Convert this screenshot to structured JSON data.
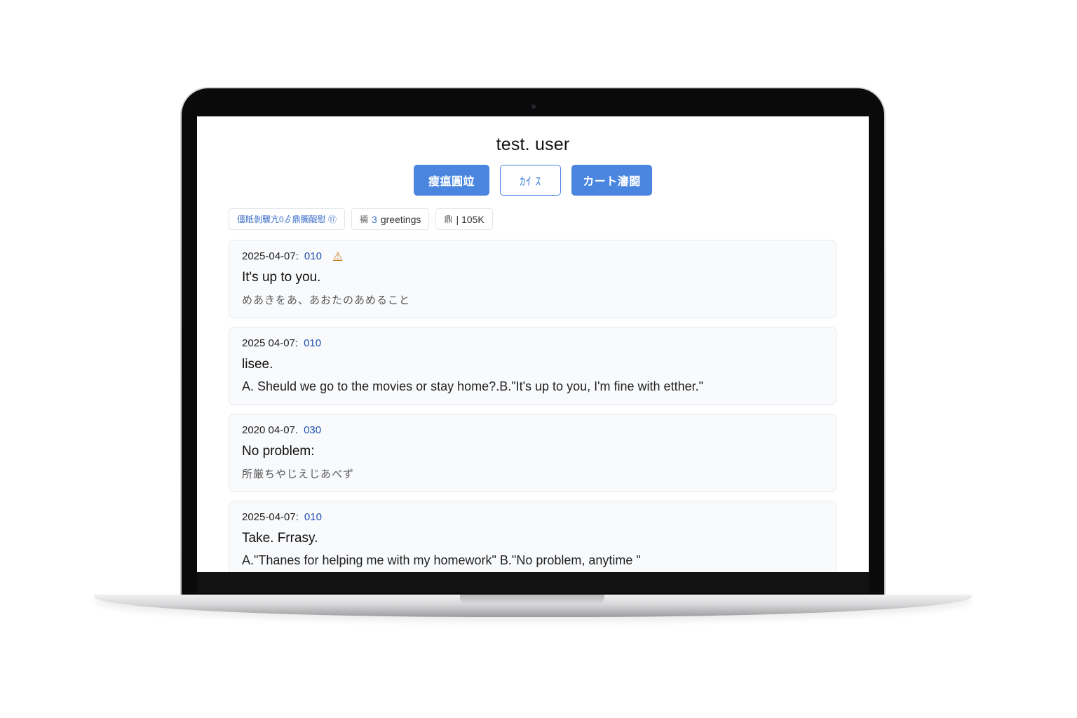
{
  "app": {
    "title": "test. user"
  },
  "actions": [
    {
      "label": "瘦瘟圓竝"
    },
    {
      "label": "ｶｲ ｽ"
    },
    {
      "label": "カート瀋闘"
    }
  ],
  "chips": [
    {
      "icon": "",
      "text": "僵眡剝驟亢0ゟ鼎髑醍慰 ⑰"
    },
    {
      "icon": "裲",
      "count": "3",
      "text": "greetings"
    },
    {
      "icon": "鼎",
      "text": "| 105K"
    }
  ],
  "entries": [
    {
      "date": "2025-04-07:",
      "code": "010",
      "warn": "⚠",
      "phrase": "It's up to you.",
      "detail": "めあきをあ、あおたのあめること"
    },
    {
      "date": "2025 04-07:",
      "code": "010",
      "phrase": "lisee.",
      "detail": "A. Sheuld we go to the movies or stay home?.B.\"It's up to you, I'm fine with etther.\""
    },
    {
      "date": "2020 04-07.",
      "code": "030",
      "phrase": "No problem:",
      "detail": "所厳ちやじえじあべず"
    },
    {
      "date": "2025-04-07:",
      "code": "010",
      "phrase": "Take. Frrasy.",
      "detail": "A.\"Thanes for helping me with my homework\" B.\"No problem, anytime \""
    }
  ]
}
